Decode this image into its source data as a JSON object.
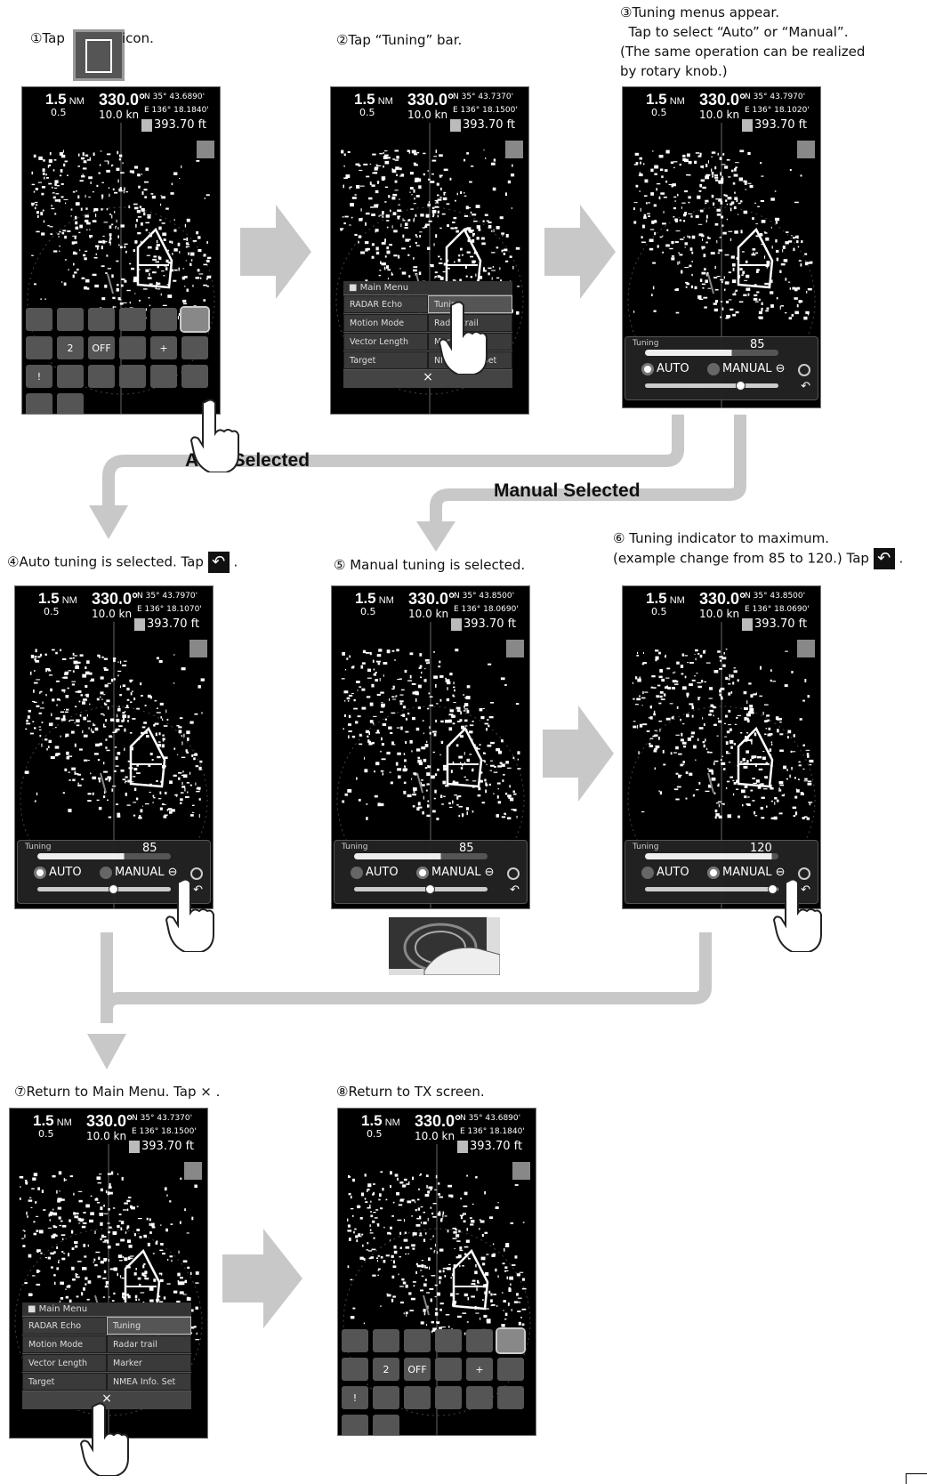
{
  "steps": {
    "s1_pre": "①Tap",
    "s1_post": "icon.",
    "s2": "②Tap “Tuning” bar.",
    "s3_l1": "③Tuning menus appear.",
    "s3_l2": "  Tap to select “Auto” or “Manual”.",
    "s3_l3": "(The same operation can be realized",
    "s3_l4": "by rotary knob.)",
    "s4": "④Auto tuning is selected. Tap",
    "s5": "⑤ Manual tuning is selected.",
    "s6_l1": "⑥ Tuning indicator to maximum.",
    "s6_l2": "(example change from 85 to 120.) Tap",
    "s7": "⑦Return to Main Menu. Tap ×",
    "s8": "⑧Return to TX screen.",
    "period": "."
  },
  "flow": {
    "auto": "Auto Selected",
    "manual": "Manual Selected"
  },
  "screens": [
    {
      "range": "1.5",
      "unit": "NM",
      "sub": "0.5",
      "bearing": "330.0°",
      "speed": "10.0 kn",
      "lat": "N  35° 43.6890'",
      "lon": "E 136° 18.1840'",
      "alt": "393.70 ft"
    },
    {
      "range": "1.5",
      "unit": "NM",
      "sub": "0.5",
      "bearing": "330.0°",
      "speed": "10.0 kn",
      "lat": "N  35° 43.7370'",
      "lon": "E 136° 18.1500'",
      "alt": "393.70 ft"
    },
    {
      "range": "1.5",
      "unit": "NM",
      "sub": "0.5",
      "bearing": "330.0°",
      "speed": "10.0 kn",
      "lat": "N  35° 43.7970'",
      "lon": "E 136° 18.1020'",
      "alt": "393.70 ft"
    },
    {
      "range": "1.5",
      "unit": "NM",
      "sub": "0.5",
      "bearing": "330.0°",
      "speed": "10.0 kn",
      "lat": "N  35° 43.7970'",
      "lon": "E 136° 18.1070'",
      "alt": "393.70 ft"
    },
    {
      "range": "1.5",
      "unit": "NM",
      "sub": "0.5",
      "bearing": "330.0°",
      "speed": "10.0 kn",
      "lat": "N  35° 43.8500'",
      "lon": "E 136° 18.0690'",
      "alt": "393.70 ft"
    },
    {
      "range": "1.5",
      "unit": "NM",
      "sub": "0.5",
      "bearing": "330.0°",
      "speed": "10.0 kn",
      "lat": "N  35° 43.8500'",
      "lon": "E 136° 18.0690'",
      "alt": "393.70 ft"
    },
    {
      "range": "1.5",
      "unit": "NM",
      "sub": "0.5",
      "bearing": "330.0°",
      "speed": "10.0 kn",
      "lat": "N  35° 43.7370'",
      "lon": "E 136° 18.1500'",
      "alt": "393.70 ft"
    },
    {
      "range": "1.5",
      "unit": "NM",
      "sub": "0.5",
      "bearing": "330.0°",
      "speed": "10.0 kn",
      "lat": "N  35° 43.6890'",
      "lon": "E 136° 18.1840'",
      "alt": "393.70 ft"
    }
  ],
  "menu": {
    "title": "Main Menu",
    "rows": [
      [
        "RADAR Echo",
        "Tuning"
      ],
      [
        "Motion Mode",
        "Radar trail"
      ],
      [
        "Vector Length",
        "Marker"
      ],
      [
        "Target",
        "NMEA Info. Set"
      ]
    ],
    "close": "×"
  },
  "tuning": {
    "label": "Tuning",
    "auto": "AUTO",
    "manual": "MANUAL",
    "val_a": "85",
    "val_b": "120",
    "return_icon": "return-arrow"
  },
  "icons": [
    "snow",
    "rain",
    "brightness",
    "color",
    "palette",
    "screen",
    "person-1",
    "person-2",
    "off",
    "line",
    "cross",
    "small-icon",
    "alert",
    "circle",
    "signal",
    "pin",
    "angle",
    "clock",
    "sweep",
    "curve"
  ],
  "colors": {
    "screen_bg": "#000000",
    "arrow_gray": "#c8c8c8"
  }
}
